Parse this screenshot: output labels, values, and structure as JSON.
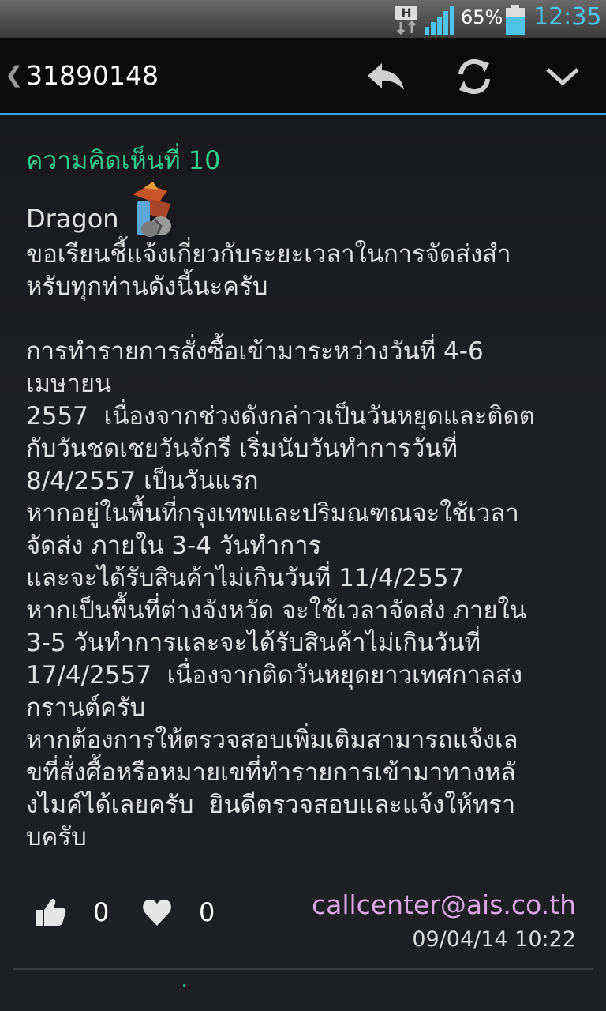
{
  "status_bar": {
    "network_badge": "H",
    "battery_percent": "65%",
    "time": "12:35",
    "accent_color": "#4fc3e8"
  },
  "action_bar": {
    "back_glyph": "❮",
    "title": "31890148",
    "icons": [
      "reply-icon",
      "refresh-icon",
      "chevron-down-icon"
    ]
  },
  "comment": {
    "header": "ความคิดเห็นที่ 10",
    "author": "Dragon",
    "body": "ขอเรียนชี้แจ้งเกี่ยวกับระยะเวลาในการจัดส่งสำ\nหรับทุกท่านดังนี้นะครับ\n\nการทำรายการสั่งซื้อเข้ามาระหว่างวันที่ 4-6\nเมษายน\n2557  เนื่องจากช่วงดังกล่าวเป็นวันหยุดและติดต\nกับวันชดเชยวันจักรี เริ่มนับวันทำการวันที่\n8/4/2557 เป็นวันแรก\nหากอยู่ในพื้นที่กรุงเทพและปริมณฑณจะใช้เวลา\nจัดส่ง ภายใน 3-4 วันทำการ\nและจะได้รับสินค้าไม่เกินวันที่ 11/4/2557\nหากเป็นพื้นที่ต่างจังหวัด จะใช้เวลาจัดส่ง ภายใน\n3-5 วันทำการและจะได้รับสินค้าไม่เกินวันที่\n17/4/2557  เนื่องจากติดวันหยุดยาวเทศกาลสง\nกรานต์ครับ\nหากต้องการให้ตรวจสอบเพิ่มเติมสามารถแจ้งเล\nขที่สั่งศื้อหรือหมายเขที่ทำรายการเข้ามาทางหลั\nงไมค์ได้เลยครับ  ยินดีตรวจสอบและแจ้งให้ทรา\nบครับ",
    "like_count": "0",
    "heart_count": "0",
    "email": "callcenter@ais.co.th",
    "timestamp": "09/04/14 10:22",
    "header_color": "#2ecc8f",
    "email_color": "#d9a6e3"
  }
}
